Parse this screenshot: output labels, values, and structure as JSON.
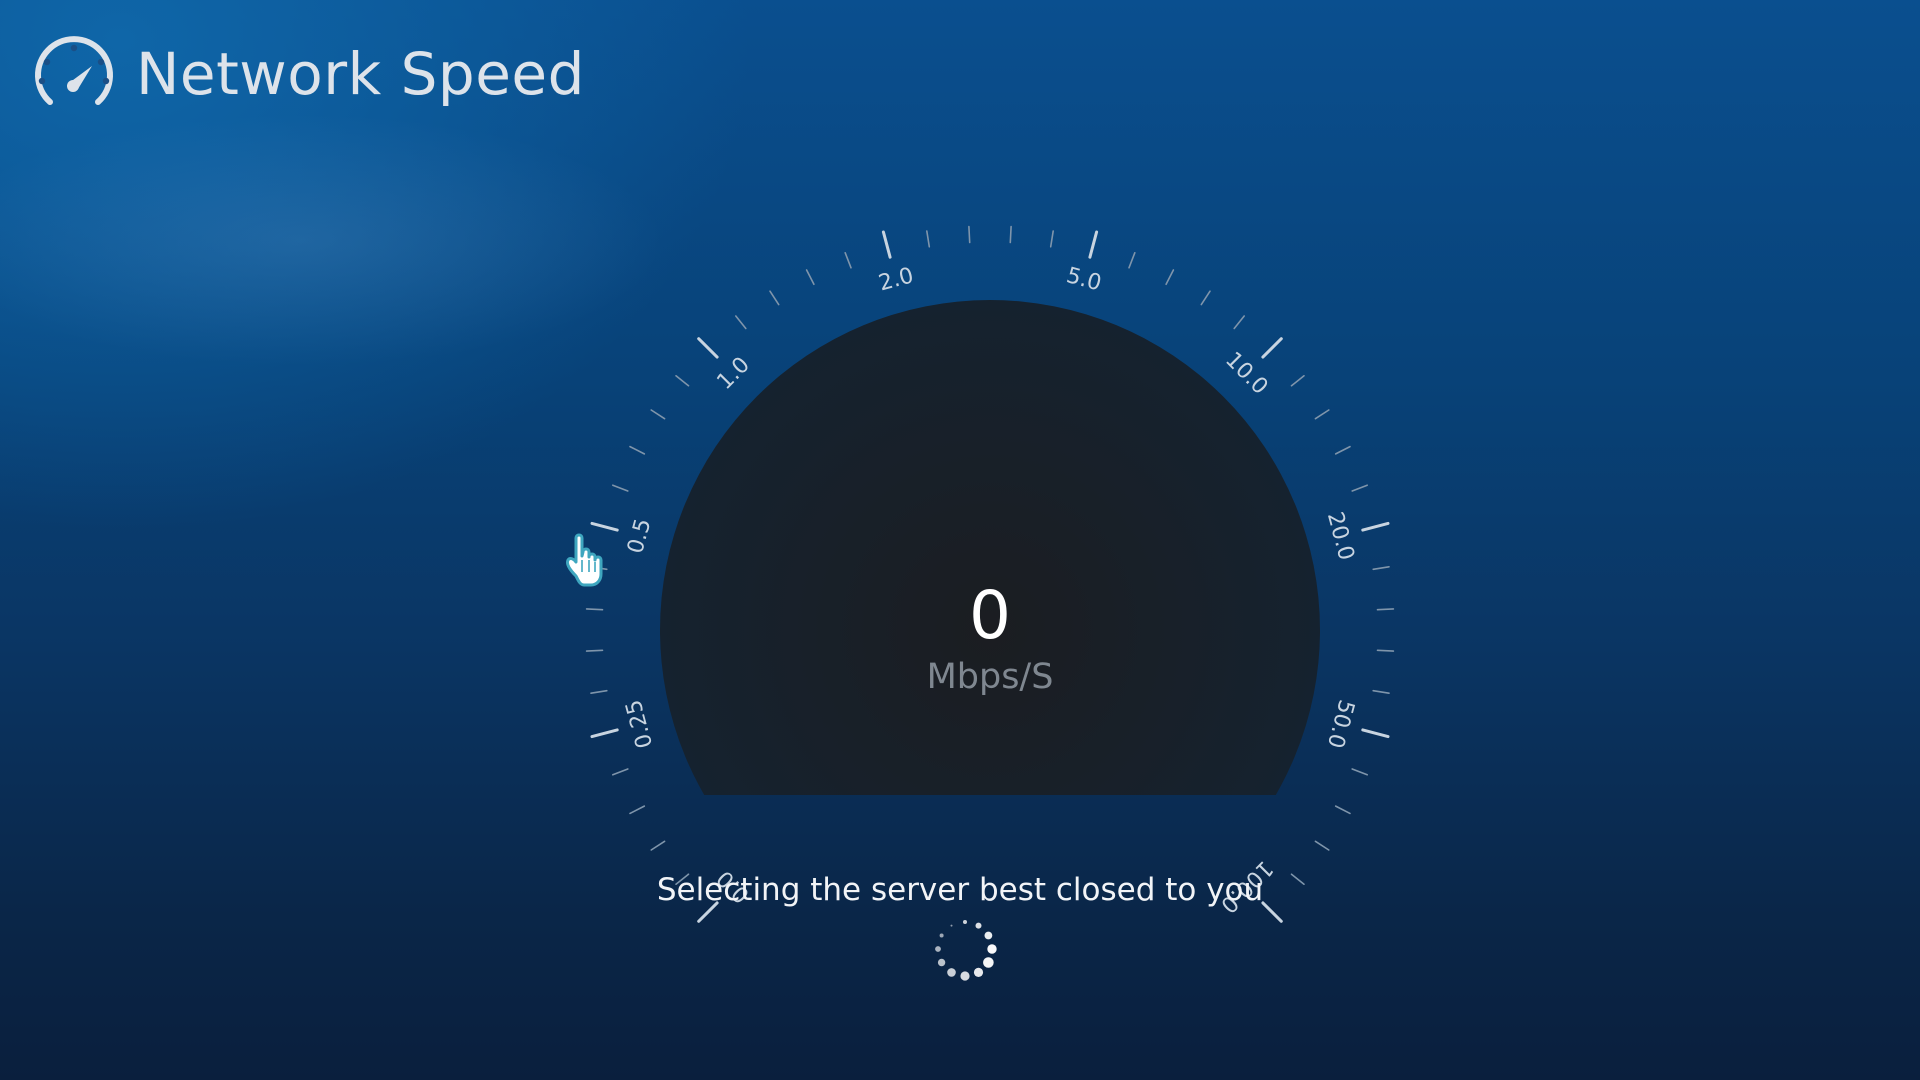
{
  "app": {
    "title": "Network Speed",
    "icon": "speedometer-icon"
  },
  "gauge": {
    "speed_value": "0",
    "unit": "Mbps/S",
    "needle_fraction": 0,
    "scale_labels": [
      "0.0",
      "0.25",
      "0.5",
      "1.0",
      "2.0",
      "5.0",
      "10.0",
      "20.0",
      "50.0",
      "100.0"
    ]
  },
  "status": {
    "message": "Selecting the server best closed to you",
    "spinner_icon": "loading-spinner-icon"
  },
  "cursor": {
    "icon": "hand-pointer-icon"
  },
  "colors": {
    "background_top": "#0a4f8f",
    "background_bottom": "#0a1f3d",
    "dial_face": "#16202c",
    "text_primary": "#ffffff",
    "text_unit": "#7f8790",
    "tick": "#9fb3c8"
  }
}
